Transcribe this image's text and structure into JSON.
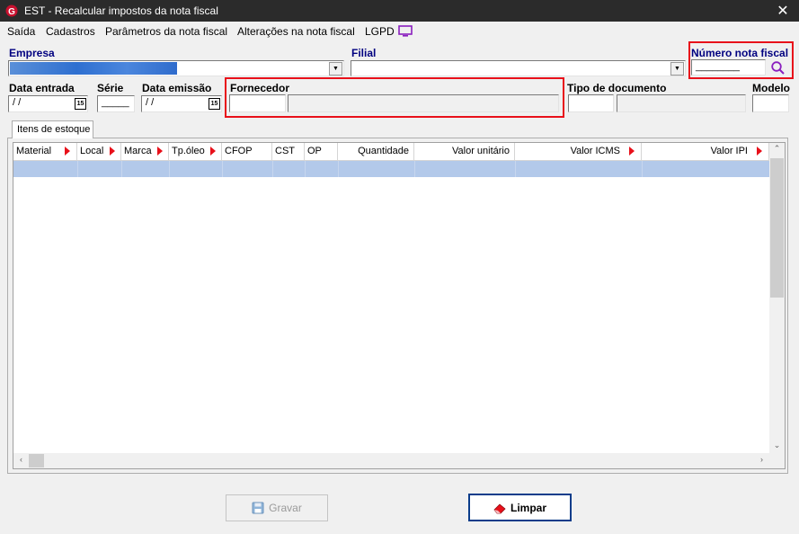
{
  "window": {
    "title": "EST - Recalcular impostos da nota fiscal",
    "close_symbol": "✕"
  },
  "menu": {
    "items": [
      "Saída",
      "Cadastros",
      "Parâmetros da nota fiscal",
      "Alterações na nota fiscal",
      "LGPD"
    ],
    "lgpd_icon": "monitor-icon"
  },
  "form": {
    "empresa_label": "Empresa",
    "filial_label": "Filial",
    "numero_nf_label": "Número nota fiscal",
    "numero_nf_value": "________",
    "data_entrada_label": "Data entrada",
    "data_entrada_value": " / /",
    "serie_label": "Série",
    "serie_value": "_____",
    "data_emissao_label": "Data emissão",
    "data_emissao_value": " / /",
    "calendar_day": "15",
    "fornecedor_label": "Fornecedor",
    "tipo_documento_label": "Tipo de documento",
    "modelo_label": "Modelo"
  },
  "tabs": [
    "Itens de estoque"
  ],
  "grid": {
    "columns": [
      {
        "label": "Material",
        "arrow": true
      },
      {
        "label": "Local",
        "arrow": true
      },
      {
        "label": "Marca",
        "arrow": true
      },
      {
        "label": "Tp.óleo",
        "arrow": true
      },
      {
        "label": "CFOP",
        "arrow": false
      },
      {
        "label": "CST",
        "arrow": false
      },
      {
        "label": "OP",
        "arrow": false
      },
      {
        "label": "Quantidade",
        "arrow": false
      },
      {
        "label": "Valor unitário",
        "arrow": false
      },
      {
        "label": "Valor ICMS",
        "arrow": true
      },
      {
        "label": "Valor IPI",
        "arrow": true
      }
    ]
  },
  "buttons": {
    "gravar": "Gravar",
    "limpar": "Limpar"
  },
  "colors": {
    "highlight_red": "#e8101a",
    "label_navy": "#000080",
    "selected_row": "#b3c9ea"
  }
}
